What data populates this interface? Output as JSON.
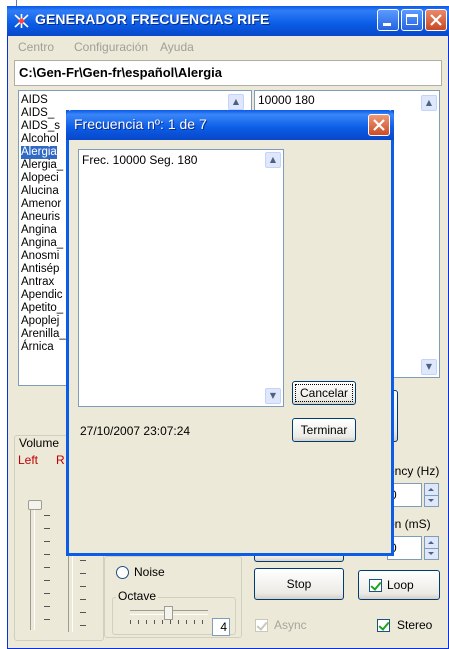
{
  "window": {
    "title": "GENERADOR FRECUENCIAS RIFE",
    "menu": [
      "Centro",
      "Configuración",
      "Ayuda"
    ],
    "path": "C:\\Gen-Fr\\Gen-fr\\español\\Alergia"
  },
  "ailments": {
    "items": [
      "AIDS",
      "AIDS_",
      "AIDS_s",
      "Alcohol",
      "Alergia",
      "Alergia_",
      "Alopeci",
      "Alucina",
      "Amenor",
      "Aneuris",
      "Angina",
      "Angina_",
      "Anosmi",
      "Antisép",
      "Antrax",
      "Apendic",
      "Apetito_",
      "Apoplej",
      "Arenilla_",
      "Árnica"
    ],
    "selected": "Alergia"
  },
  "freq_list": {
    "first_line": "10000  180"
  },
  "controls": {
    "volume_label": "Volume",
    "left_label": "Left",
    "right_label": "R",
    "frequency_label": "ency (Hz)",
    "duration_label": "on (mS)",
    "frequency_value": "0",
    "duration_value": "0",
    "noise_label": "Noise",
    "octave_label": "Octave",
    "octave_value": "4",
    "stop_label": "Stop",
    "loop_label": "Loop",
    "loop_checked": true,
    "async_label": "Async",
    "async_checked": true,
    "stereo_label": "Stereo",
    "stereo_checked": true
  },
  "dialog": {
    "title": "Frecuencia nº: 1 de 7",
    "memo_text": "Frec. 10000 Seg. 180",
    "cancel_label": "Cancelar",
    "finish_label": "Terminar",
    "timestamp": "27/10/2007 23:07:24"
  },
  "colors": {
    "titlebar": "#0b5ce6",
    "selection": "#316ac5",
    "face": "#ece9d8",
    "left_label": "#c00000"
  }
}
